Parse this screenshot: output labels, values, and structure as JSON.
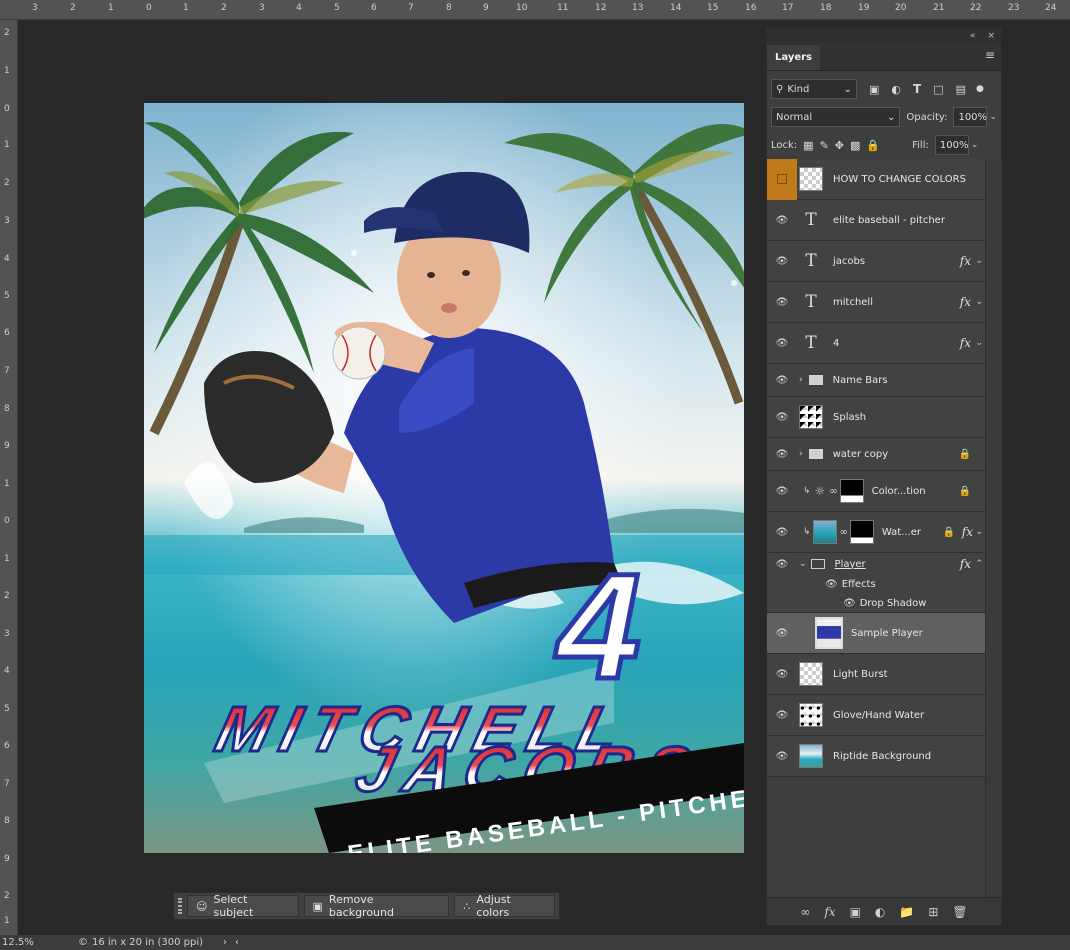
{
  "ruler": {
    "top_labels": [
      "3",
      "2",
      "1",
      "0",
      "1",
      "2",
      "3",
      "4",
      "5",
      "6",
      "7",
      "8",
      "9",
      "10",
      "11",
      "12",
      "13",
      "14",
      "15",
      "16",
      "17",
      "18",
      "19",
      "20",
      "21",
      "22",
      "23",
      "24"
    ],
    "left_labels": [
      "2",
      "1",
      "0",
      "1",
      "2",
      "3",
      "4",
      "5",
      "6",
      "7",
      "8",
      "9",
      "1",
      "0",
      "1",
      "2",
      "3",
      "4",
      "5",
      "6",
      "7",
      "8",
      "9",
      "2",
      "1",
      "2"
    ]
  },
  "artwork": {
    "name_line1": "MITCHELL",
    "name_line2": "JACOBS",
    "number": "4",
    "banner": "ELITE BASEBALL - PITCHER"
  },
  "context_bar": {
    "select_subject": "Select subject",
    "remove_background": "Remove background",
    "adjust_colors": "Adjust colors"
  },
  "status_bar": {
    "zoom": "12.5%",
    "doc_info": "16 in x 20 in (300 ppi)"
  },
  "layers_panel": {
    "tab": "Layers",
    "filter_kind": "Kind",
    "blend_mode": "Normal",
    "opacity_label": "Opacity:",
    "opacity_value": "100%",
    "lock_label": "Lock:",
    "fill_label": "Fill:",
    "fill_value": "100%",
    "layers": [
      {
        "name": "HOW TO CHANGE COLORS"
      },
      {
        "name": "elite baseball - pitcher"
      },
      {
        "name": "jacobs",
        "fx": "fx"
      },
      {
        "name": "mitchell",
        "fx": "fx"
      },
      {
        "name": "4",
        "fx": "fx"
      },
      {
        "name": "Name Bars"
      },
      {
        "name": "Splash"
      },
      {
        "name": "water copy"
      },
      {
        "name": "Color...tion"
      },
      {
        "name": "Wat...er",
        "fx": "fx"
      },
      {
        "name": "Player",
        "fx": "fx"
      },
      {
        "name": "Effects"
      },
      {
        "name": "Drop Shadow"
      },
      {
        "name": "Sample Player"
      },
      {
        "name": "Light Burst"
      },
      {
        "name": "Glove/Hand Water"
      },
      {
        "name": "Riptide Background"
      }
    ]
  },
  "colors": {
    "accent_orange": "#c07a1a",
    "selected_layer": "#606060",
    "panel_bg": "#3e3e3e"
  }
}
